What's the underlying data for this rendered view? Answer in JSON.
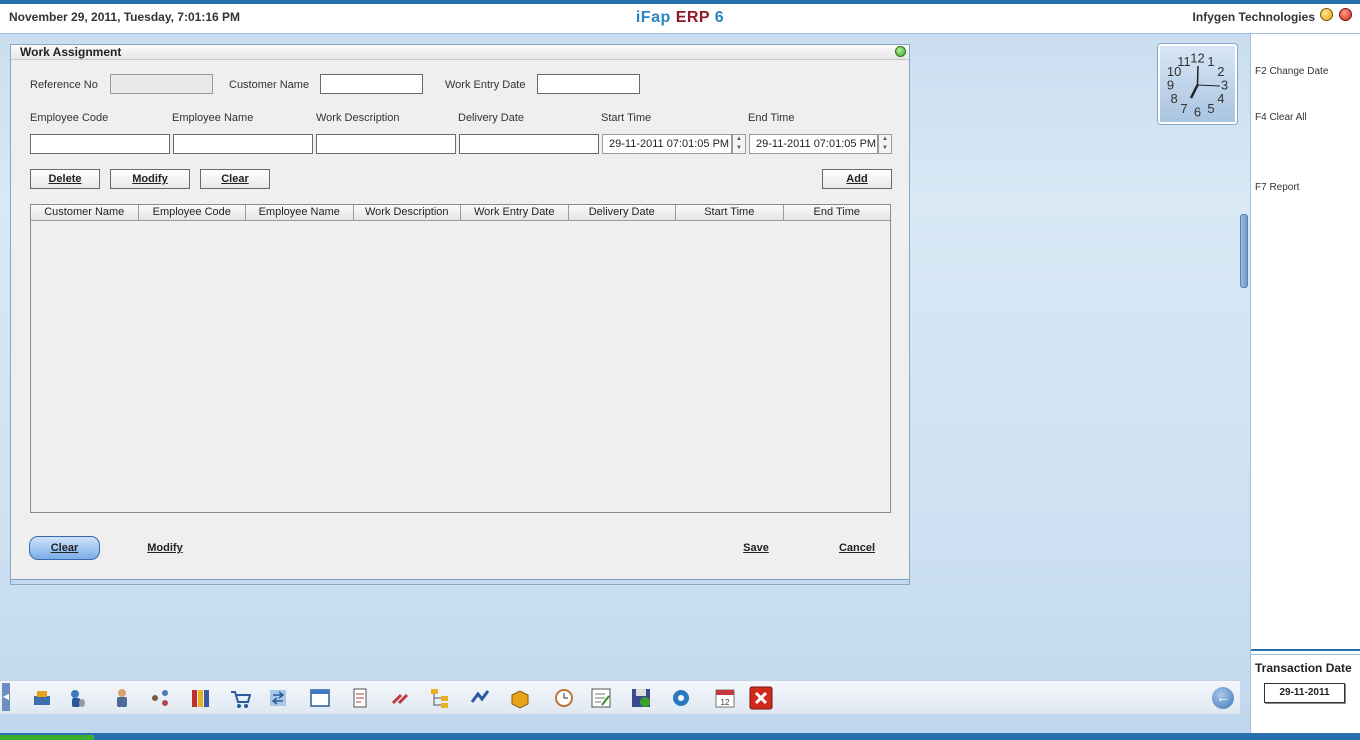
{
  "header": {
    "datetime": "November  29, 2011, Tuesday, 7:01:16 PM",
    "title_part1": "iFap ",
    "title_part2": "ERP",
    "title_part3": " 6",
    "company": "Infygen Technologies"
  },
  "form": {
    "title": "Work Assignment",
    "reference_no_label": "Reference No",
    "reference_no_value": "",
    "customer_name_label": "Customer Name",
    "customer_name_value": "",
    "work_entry_date_label": "Work Entry Date",
    "work_entry_date_value": "",
    "employee_code_label": "Employee Code",
    "employee_name_label": "Employee Name",
    "work_description_label": "Work Description",
    "delivery_date_label": "Delivery Date",
    "start_time_label": "Start Time",
    "start_time_value": "29-11-2011 07:01:05 PM",
    "end_time_label": "End Time",
    "end_time_value": "29-11-2011 07:01:05 PM",
    "delete_label": "Delete",
    "modify_label": "Modify",
    "clear_label": "Clear",
    "add_label": "Add"
  },
  "table": {
    "columns": [
      "Customer Name",
      "Employee Code",
      "Employee Name",
      "Work Description",
      "Work Entry Date",
      "Delivery Date",
      "Start Time",
      "End Time"
    ],
    "rows": []
  },
  "footer": {
    "clear_label": "Clear",
    "modify_label": "Modify",
    "save_label": "Save",
    "cancel_label": "Cancel"
  },
  "sidebar": {
    "change_date": "F2 Change Date",
    "clear_all": "F4 Clear All",
    "report": "F7 Report",
    "transaction_date_label": "Transaction Date",
    "transaction_date_value": "29-11-2011"
  },
  "clock": {
    "numerals": [
      "12",
      "1",
      "2",
      "3",
      "4",
      "5",
      "6",
      "7",
      "8",
      "9",
      "10",
      "11"
    ],
    "time": "7:01"
  },
  "toolbar": {
    "icons": [
      "inventory-icon",
      "user-mouse-icon",
      "employee-icon",
      "network-icon",
      "books-icon",
      "cart-icon",
      "exchange-icon",
      "window-icon",
      "document-icon",
      "tools-icon",
      "tree-icon",
      "arrows-icon",
      "box-icon",
      "clock-tool-icon",
      "checklist-icon",
      "save-disk-icon",
      "settings-icon",
      "calendar-icon",
      "exit-icon"
    ],
    "calendar_day": "12"
  },
  "colors": {
    "accent_blue": "#2a6fb0",
    "brand_red": "#8e1a26",
    "title_blue": "#2a86c4"
  }
}
